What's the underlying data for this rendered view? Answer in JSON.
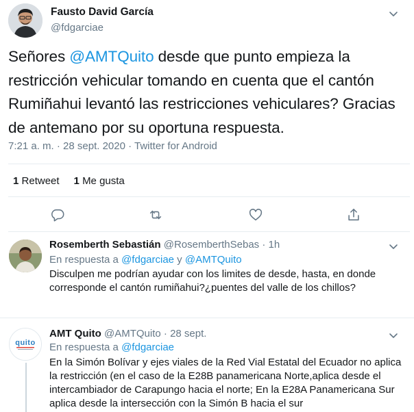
{
  "tweet": {
    "author_name": "Fausto David García",
    "author_handle": "@fdgarciae",
    "text_before": "Señores ",
    "text_mention": "@AMTQuito",
    "text_after": " desde que punto empieza la restricción vehicular tomando en cuenta que el cantón Rumiñahui levantó las restricciones vehiculares? Gracias de antemano por su oportuna respuesta.",
    "meta": "7:21 a. m. · 28 sept. 2020 · Twitter for Android",
    "retweet_count": "1",
    "retweet_label": "Retweet",
    "like_count": "1",
    "like_label": "Me gusta"
  },
  "replies": [
    {
      "name": "Rosemberth Sebastián",
      "handle_time": "@RosemberthSebas · 1h",
      "reply_to_prefix": "En respuesta a ",
      "reply_to_1": "@fdgarciae",
      "reply_to_join": " y ",
      "reply_to_2": "@AMTQuito",
      "text": "Disculpen me podrían ayudar con los limites de desde, hasta, en donde corresponde el cantón rumiñahui?¿puentes del valle de los chillos?"
    },
    {
      "name": "AMT Quito",
      "handle_time": "@AMTQuito · 28 sept.",
      "reply_to_prefix": "En respuesta a ",
      "reply_to_1": "@fdgarciae",
      "logo_text": "quito",
      "text": "En la Simón Bolívar y ejes viales de la Red Vial Estatal del Ecuador no aplica la restricción (en el caso de la E28B panamericana Norte,aplica desde el intercambiador de Carapungo hacia el norte; En la E28A Panamericana Sur aplica desde la intersección con la Simón B hacia el sur"
    }
  ],
  "icons": {
    "more": "chevron-down-icon",
    "reply": "reply-icon",
    "retweet": "retweet-icon",
    "like": "like-icon",
    "share": "share-icon"
  },
  "colors": {
    "link": "#1b95e0",
    "secondary_text": "#657786",
    "divider": "#e6ecf0"
  }
}
